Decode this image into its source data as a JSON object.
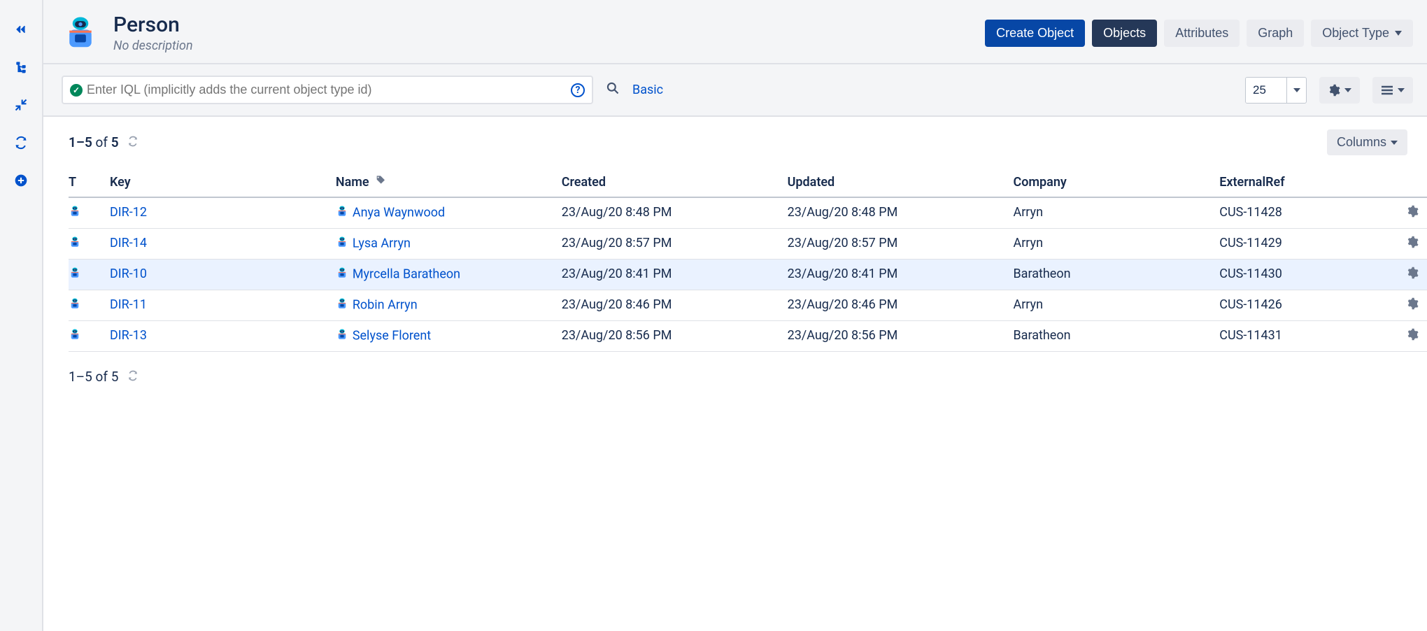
{
  "header": {
    "title": "Person",
    "description": "No description",
    "create_label": "Create Object",
    "tabs": {
      "objects": "Objects",
      "attributes": "Attributes",
      "graph": "Graph"
    },
    "object_type_label": "Object Type"
  },
  "toolbar": {
    "search_placeholder": "Enter IQL (implicitly adds the current object type id)",
    "basic_link": "Basic",
    "page_size": "25"
  },
  "pagination": {
    "range": "1–5",
    "of": "of",
    "total": "5"
  },
  "columns_button": "Columns",
  "table": {
    "headers": {
      "type": "T",
      "key": "Key",
      "name": "Name",
      "created": "Created",
      "updated": "Updated",
      "company": "Company",
      "externalRef": "ExternalRef"
    },
    "rows": [
      {
        "key": "DIR-12",
        "name": "Anya Waynwood",
        "created": "23/Aug/20 8:48 PM",
        "updated": "23/Aug/20 8:48 PM",
        "company": "Arryn",
        "externalRef": "CUS-11428",
        "highlight": false
      },
      {
        "key": "DIR-14",
        "name": "Lysa Arryn",
        "created": "23/Aug/20 8:57 PM",
        "updated": "23/Aug/20 8:57 PM",
        "company": "Arryn",
        "externalRef": "CUS-11429",
        "highlight": false
      },
      {
        "key": "DIR-10",
        "name": "Myrcella Baratheon",
        "created": "23/Aug/20 8:41 PM",
        "updated": "23/Aug/20 8:41 PM",
        "company": "Baratheon",
        "externalRef": "CUS-11430",
        "highlight": true
      },
      {
        "key": "DIR-11",
        "name": "Robin Arryn",
        "created": "23/Aug/20 8:46 PM",
        "updated": "23/Aug/20 8:46 PM",
        "company": "Arryn",
        "externalRef": "CUS-11426",
        "highlight": false
      },
      {
        "key": "DIR-13",
        "name": "Selyse Florent",
        "created": "23/Aug/20 8:56 PM",
        "updated": "23/Aug/20 8:56 PM",
        "company": "Baratheon",
        "externalRef": "CUS-11431",
        "highlight": false
      }
    ]
  }
}
